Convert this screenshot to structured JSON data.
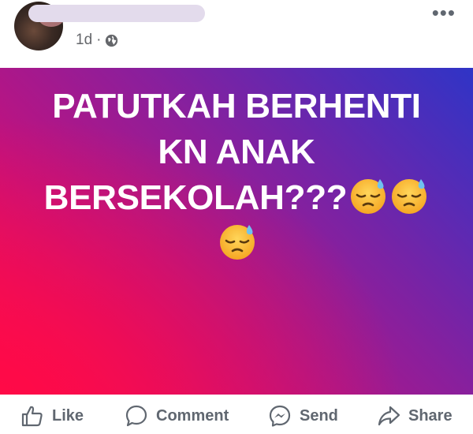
{
  "post": {
    "time": "1d",
    "separator": "·",
    "privacy_icon": "globe-icon",
    "more_icon": "more-options-icon",
    "text_line1": "PATUTKAH BERHENTI",
    "text_line2": "KN ANAK",
    "text_line3": "BERSEKOLAH???",
    "emoji": "downcast-face-with-sweat-emoji",
    "emoji_count": 3,
    "gradient": [
      "#ff0b52",
      "#c1127e",
      "#8a1f9c",
      "#5a2ab4",
      "#2f34c6"
    ]
  },
  "actions": {
    "like": {
      "label": "Like",
      "icon": "like-icon"
    },
    "comment": {
      "label": "Comment",
      "icon": "comment-icon"
    },
    "send": {
      "label": "Send",
      "icon": "messenger-icon"
    },
    "share": {
      "label": "Share",
      "icon": "share-icon"
    }
  },
  "colors": {
    "action_text": "#606770",
    "meta_text": "#65676b"
  }
}
